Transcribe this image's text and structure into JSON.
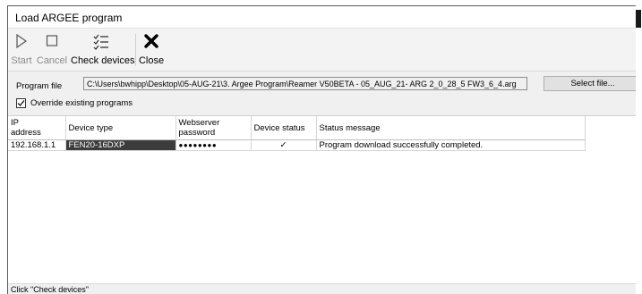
{
  "window": {
    "title": "Load ARGEE program"
  },
  "toolbar": {
    "start_label": "Start",
    "cancel_label": "Cancel",
    "check_devices_label": "Check devices",
    "close_label": "Close"
  },
  "program_file": {
    "label": "Program file",
    "value": "C:\\Users\\bwhipp\\Desktop\\05-AUG-21\\3. Argee Program\\Reamer V50BETA - 05_AUG_21- ARG 2_0_28_5 FW3_6_4.arg",
    "select_button_label": "Select file..."
  },
  "override": {
    "label": "Override existing programs",
    "checked": true
  },
  "table": {
    "headers": {
      "ip_line1": "IP",
      "ip_line2": "address",
      "device_type": "Device type",
      "webserver_line1": "Webserver",
      "webserver_line2": "password",
      "device_status": "Device status",
      "status_message": "Status message"
    },
    "rows": [
      {
        "ip_address": "192.168.1.1",
        "device_type": "FEN20-16DXP",
        "password": "●●●●●●●●",
        "device_status": "✓",
        "status_message": "Program download successfully completed."
      }
    ]
  },
  "statusbar": {
    "text": "Click \"Check devices\""
  }
}
